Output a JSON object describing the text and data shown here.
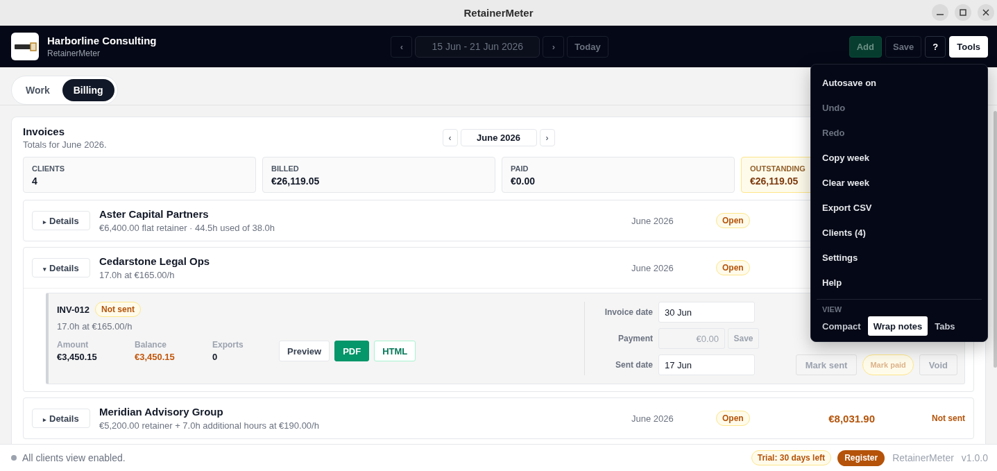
{
  "window": {
    "title": "RetainerMeter"
  },
  "header": {
    "company": "Harborline Consulting",
    "app": "RetainerMeter",
    "week_nav": {
      "prev": "‹",
      "range": "15 Jun - 21 Jun 2026",
      "next": "›",
      "today": "Today",
      "disabled": true
    },
    "actions": [
      {
        "label": "Add",
        "kind": "primary",
        "disabled": true
      },
      {
        "label": "Save",
        "kind": "plain",
        "disabled": true
      },
      {
        "label": "?",
        "kind": "outline",
        "disabled": false
      },
      {
        "label": "Tools",
        "kind": "light",
        "disabled": false
      }
    ]
  },
  "tabs": [
    {
      "label": "Work",
      "selected": false
    },
    {
      "label": "Billing",
      "selected": true
    }
  ],
  "invoices": {
    "title": "Invoices",
    "subtitle": "Totals for June 2026.",
    "month_nav": {
      "prev": "‹",
      "month": "June 2026",
      "next": "›"
    },
    "stats": [
      {
        "label": "CLIENTS",
        "value": "4",
        "highlight": false
      },
      {
        "label": "BILLED",
        "value": "€26,119.05",
        "highlight": false
      },
      {
        "label": "PAID",
        "value": "€0.00",
        "highlight": false
      },
      {
        "label": "OUTSTANDING",
        "value": "€26,119.05",
        "highlight": true
      }
    ],
    "clients": [
      {
        "caret": "▸",
        "toggle": "Details",
        "expanded": false,
        "name": "Aster Capital Partners",
        "terms": "€6,400.00 flat retainer · 44.5h used of 38.0h",
        "period": "June 2026",
        "state": "Open"
      },
      {
        "caret": "▾",
        "toggle": "Details",
        "expanded": true,
        "name": "Cedarstone Legal Ops",
        "terms": "17.0h at €165.00/h",
        "period": "June 2026",
        "state": "Open",
        "detail": {
          "number": "INV-012",
          "badge": "Not sent",
          "summary": "17.0h at €165.00/h",
          "figures": [
            {
              "label": "Amount",
              "value": "€3,450.15",
              "kind": "plain"
            },
            {
              "label": "Balance",
              "value": "€3,450.15",
              "kind": "due"
            },
            {
              "label": "Exports",
              "value": "0",
              "kind": "plain"
            }
          ],
          "exports": [
            {
              "label": "Preview",
              "kind": "plain"
            },
            {
              "label": "PDF",
              "kind": "primary"
            },
            {
              "label": "HTML",
              "kind": "outline"
            }
          ],
          "fields": [
            {
              "label": "Invoice date",
              "value": "30 Jun",
              "disabled": false
            },
            {
              "label": "Payment",
              "placeholder": "€0.00",
              "disabled": true,
              "button": "Save"
            },
            {
              "label": "Sent date",
              "value": "17 Jun",
              "disabled": false
            }
          ],
          "actions": [
            {
              "label": "Mark sent",
              "kind": "plain",
              "disabled": true
            },
            {
              "label": "Mark paid",
              "kind": "warn",
              "disabled": true
            },
            {
              "label": "Void",
              "kind": "plain",
              "disabled": true
            }
          ]
        }
      },
      {
        "caret": "▸",
        "toggle": "Details",
        "expanded": false,
        "name": "Meridian Advisory Group",
        "terms": "€5,200.00 retainer + 7.0h additional hours at €190.00/h",
        "period": "June 2026",
        "state": "Open",
        "amount": "€8,031.90",
        "status": "Not sent"
      }
    ]
  },
  "tools_menu": {
    "items": [
      {
        "label": "Autosave on",
        "disabled": false
      },
      {
        "label": "Undo",
        "disabled": true
      },
      {
        "label": "Redo",
        "disabled": true
      },
      {
        "label": "Copy week",
        "disabled": false
      },
      {
        "label": "Clear week",
        "disabled": false
      },
      {
        "label": "Export CSV",
        "disabled": false
      },
      {
        "label": "Clients (4)",
        "disabled": false
      },
      {
        "label": "Settings",
        "disabled": false
      },
      {
        "label": "Help",
        "disabled": false
      }
    ],
    "section": "VIEW",
    "view_options": [
      {
        "label": "Compact",
        "selected": false
      },
      {
        "label": "Wrap notes",
        "selected": true
      },
      {
        "label": "Tabs",
        "selected": false
      }
    ]
  },
  "status_bar": {
    "message": "All clients view enabled.",
    "trial": "Trial: 30 days left",
    "register": "Register",
    "app": "RetainerMeter",
    "version": "v1.0.0"
  }
}
